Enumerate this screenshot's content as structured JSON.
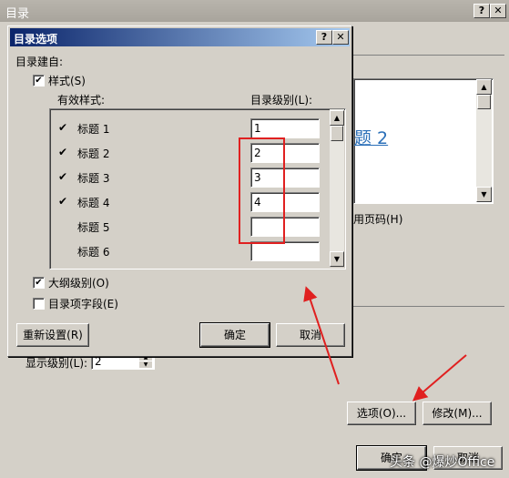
{
  "bg": {
    "title": "目录",
    "preview_text": "题 2",
    "use_hyperlinks_label": "用页码(H)",
    "show_levels_label": "显示级别(L):",
    "show_levels_value": "2",
    "options_button": "选项(O)...",
    "modify_button": "修改(M)...",
    "ok_button": "确定",
    "cancel_button": "取消",
    "watermark": "头条 @爆炒Office"
  },
  "dialog": {
    "title": "目录选项",
    "build_from": "目录建自:",
    "styles_label": "样式(S)",
    "available_styles": "有效样式:",
    "toc_level": "目录级别(L):",
    "rows": [
      {
        "name": "标题 1",
        "checked": "✔",
        "level": "1"
      },
      {
        "name": "标题 2",
        "checked": "✔",
        "level": "2"
      },
      {
        "name": "标题 3",
        "checked": "✔",
        "level": "3"
      },
      {
        "name": "标题 4",
        "checked": "✔",
        "level": "4"
      },
      {
        "name": "标题 5",
        "checked": "",
        "level": ""
      },
      {
        "name": "标题 6",
        "checked": "",
        "level": ""
      }
    ],
    "outline_levels": "大纲级别(O)",
    "toc_entry_fields": "目录项字段(E)",
    "reset_button": "重新设置(R)",
    "ok_button": "确定",
    "cancel_button": "取消",
    "help": "?",
    "close": "✕"
  },
  "colors": {
    "accent_red": "#e02020",
    "title_blue": "#0a246a",
    "link_blue": "#2a6fb8"
  }
}
